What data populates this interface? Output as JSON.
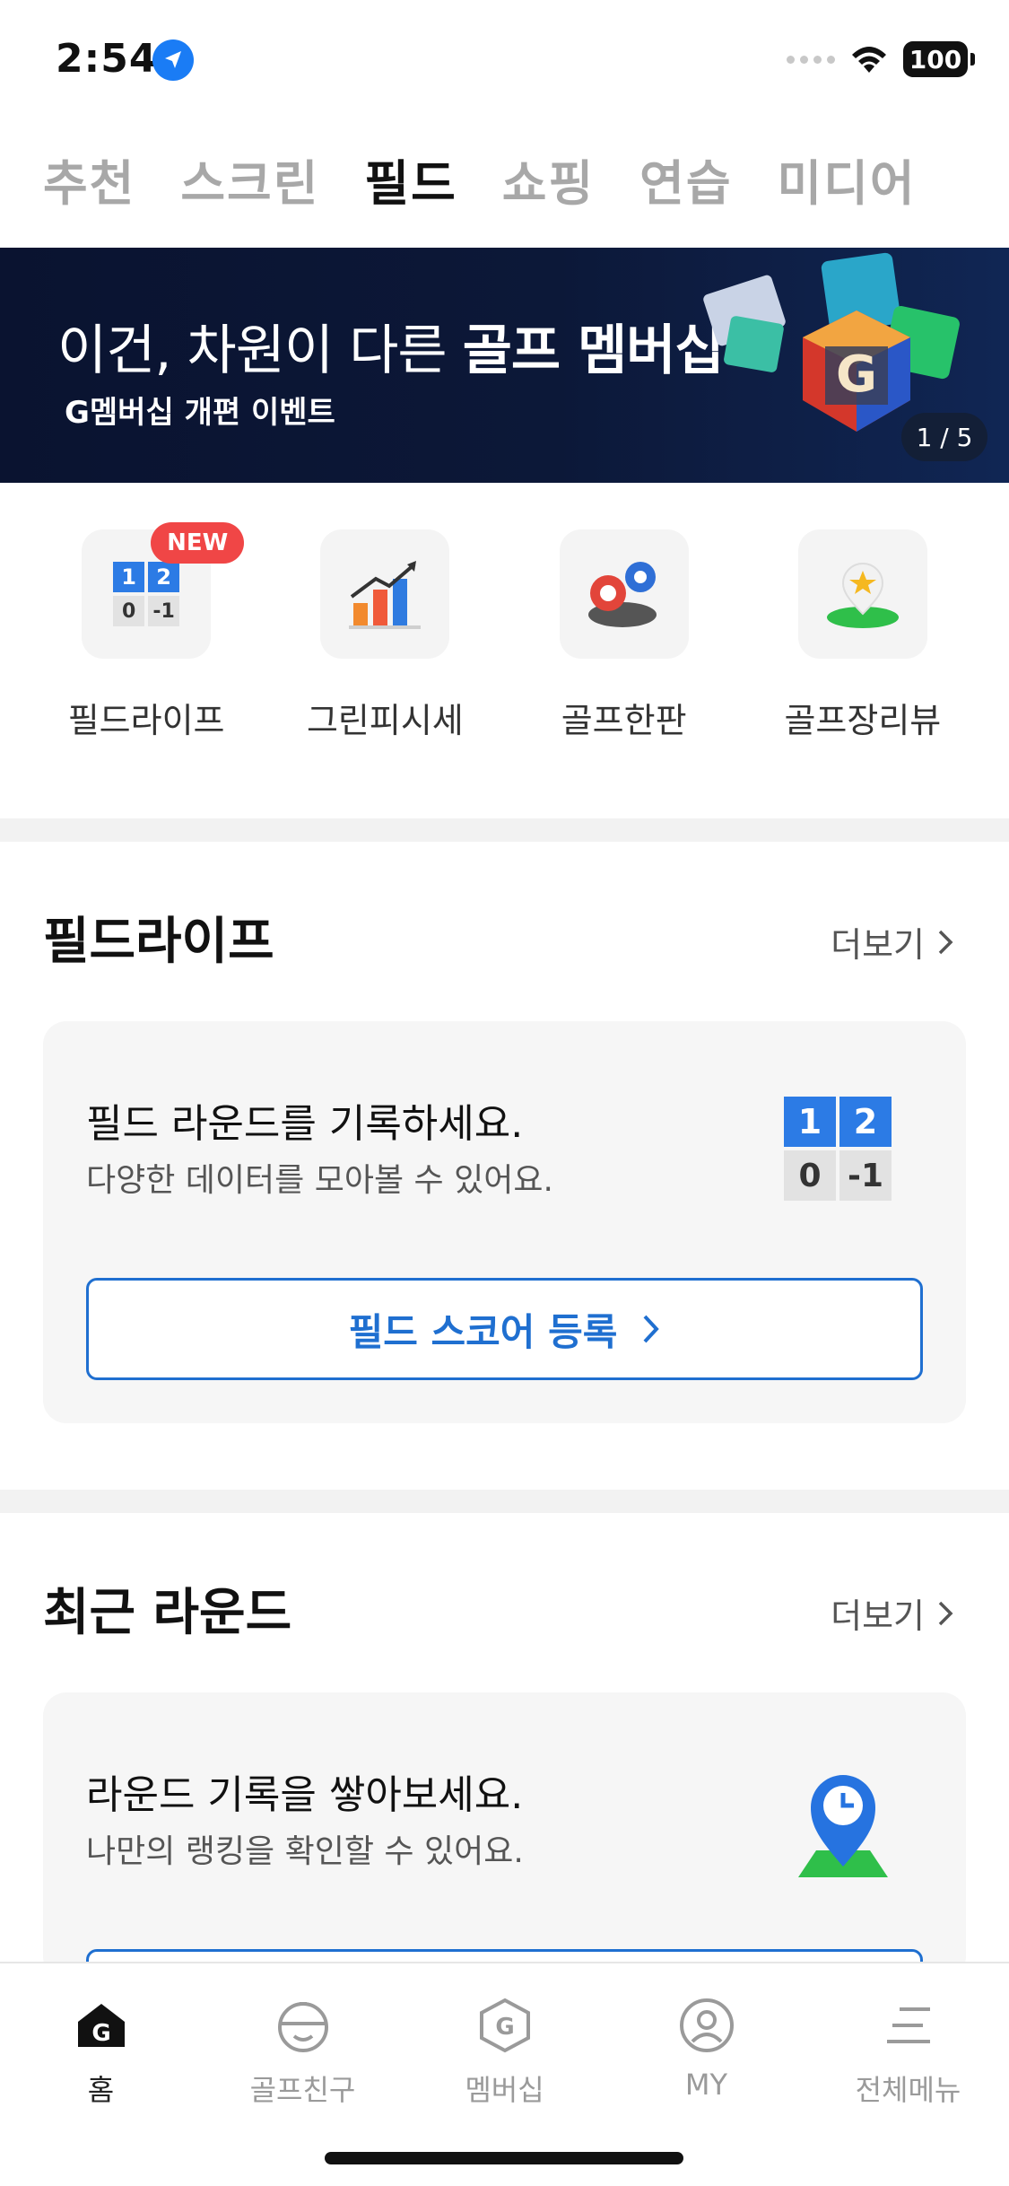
{
  "status_bar": {
    "time": "2:54",
    "battery": "100"
  },
  "top_tabs": [
    {
      "label": "추천",
      "active": false
    },
    {
      "label": "스크린",
      "active": false
    },
    {
      "label": "필드",
      "active": true
    },
    {
      "label": "쇼핑",
      "active": false
    },
    {
      "label": "연습",
      "active": false
    },
    {
      "label": "미디어",
      "active": false
    }
  ],
  "banner": {
    "title_prefix": "이건, 차원이 다른 ",
    "title_bold": "골프 멤버십",
    "subtitle": "G멤버십 개편 이벤트",
    "counter": "1 / 5",
    "art_letter": "G"
  },
  "quick_menu": [
    {
      "label": "필드라이프",
      "badge": "NEW",
      "icon": "score-board-icon"
    },
    {
      "label": "그린피시세",
      "icon": "bar-chart-icon"
    },
    {
      "label": "골프한판",
      "icon": "poker-chip-icon"
    },
    {
      "label": "골프장리뷰",
      "icon": "star-pin-icon"
    }
  ],
  "score_icon": {
    "top": [
      "1",
      "2"
    ],
    "bottom": [
      "0",
      "-1"
    ]
  },
  "field_life": {
    "title": "필드라이프",
    "more": "더보기",
    "card_title": "필드 라운드를 기록하세요.",
    "card_sub": "다양한 데이터를 모아볼 수 있어요.",
    "button": "필드 스코어 등록"
  },
  "recent_round": {
    "title": "최근 라운드",
    "more": "더보기",
    "card_title": "라운드 기록을 쌓아보세요.",
    "card_sub": "나만의 랭킹을 확인할 수 있어요."
  },
  "bottom_nav": [
    {
      "label": "홈",
      "icon": "home-g-icon",
      "active": true
    },
    {
      "label": "골프친구",
      "icon": "golf-friend-icon",
      "active": false
    },
    {
      "label": "멤버십",
      "icon": "membership-g-icon",
      "active": false
    },
    {
      "label": "MY",
      "icon": "profile-icon",
      "active": false
    },
    {
      "label": "전체메뉴",
      "icon": "menu-icon",
      "active": false
    }
  ],
  "colors": {
    "accent": "#1f6fd0",
    "badge": "#f04646",
    "banner_bg": "#0a1330"
  }
}
